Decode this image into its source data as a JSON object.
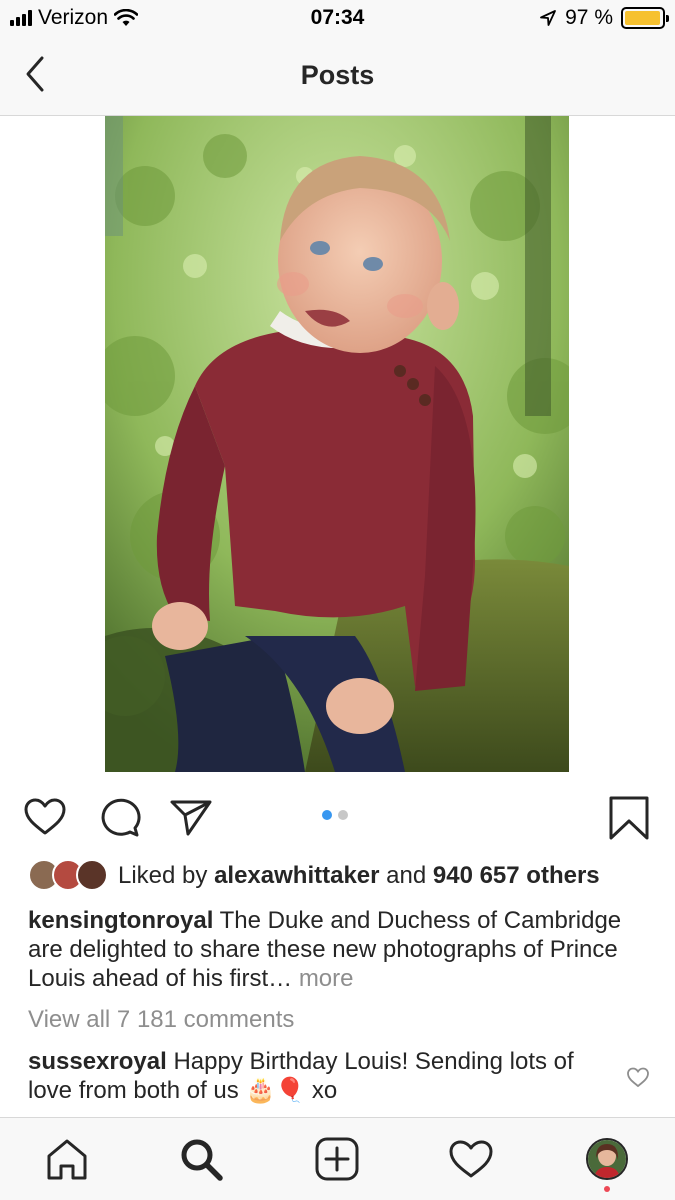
{
  "status_bar": {
    "carrier": "Verizon",
    "time": "07:34",
    "battery_label": "97 %",
    "battery_level": 0.97,
    "battery_color": "#f6c130",
    "icons": [
      "signal-icon",
      "wifi-icon",
      "location-arrow-icon",
      "battery-icon"
    ]
  },
  "nav": {
    "title": "Posts",
    "back_icon": "chevron-left-icon"
  },
  "post": {
    "photo_alt": "photo",
    "carousel": {
      "count": 2,
      "active": 1,
      "active_color": "#3897f0"
    },
    "actions": [
      "heart-icon",
      "comment-icon",
      "share-icon",
      "bookmark-icon"
    ],
    "likes": {
      "prefix": "Liked by",
      "user": "alexawhittaker",
      "conj": "and",
      "count_text": "940 657 others"
    },
    "caption": {
      "user": "kensingtonroyal",
      "text": "The Duke and Duchess of Cambridge are delighted to share these new photographs of Prince Louis ahead of his first…",
      "more": "more"
    },
    "view_all_comments": "View all 7 181 comments",
    "comment": {
      "user": "sussexroyal",
      "text": "Happy Birthday Louis! Sending lots of love from both of us 🎂🎈 xo"
    }
  },
  "tab_bar": {
    "tabs": [
      "home-icon",
      "search-icon",
      "add-post-icon",
      "activity-heart-icon",
      "profile-avatar"
    ],
    "notification_color": "#ed4956"
  }
}
